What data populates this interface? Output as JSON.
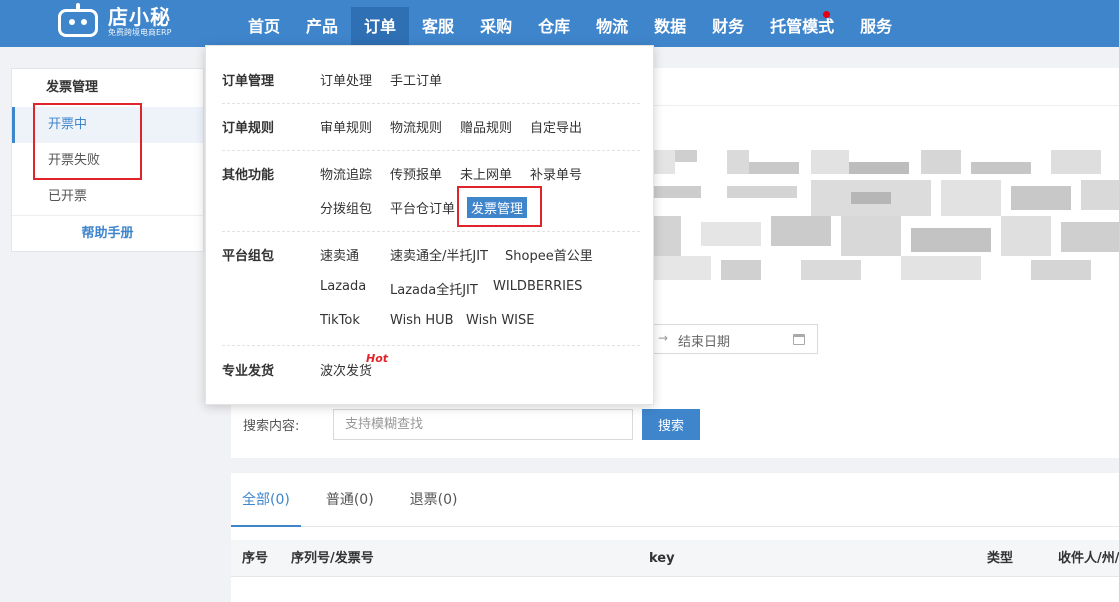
{
  "logo": {
    "name": "店小秘",
    "tagline": "免费跨境电商ERP"
  },
  "nav": {
    "items": [
      {
        "label": "首页"
      },
      {
        "label": "产品"
      },
      {
        "label": "订单"
      },
      {
        "label": "客服"
      },
      {
        "label": "采购"
      },
      {
        "label": "仓库"
      },
      {
        "label": "物流"
      },
      {
        "label": "数据"
      },
      {
        "label": "财务"
      },
      {
        "label": "托管模式"
      },
      {
        "label": "服务"
      }
    ],
    "active_index": 2,
    "badge_index": 9
  },
  "sidebar": {
    "title": "发票管理",
    "items": [
      {
        "label": "开票中"
      },
      {
        "label": "开票失败"
      },
      {
        "label": "已开票"
      }
    ],
    "active_index": 0,
    "help": "帮助手册"
  },
  "dropdown": {
    "groups": [
      {
        "category": "订单管理",
        "links": [
          "订单处理",
          "手工订单"
        ]
      },
      {
        "category": "订单规则",
        "links": [
          "审单规则",
          "物流规则",
          "赠品规则",
          "自定导出"
        ]
      },
      {
        "category": "其他功能",
        "links": [
          "物流追踪",
          "传预报单",
          "未上网单",
          "补录单号",
          "分拨组包",
          "平台仓订单",
          "发票管理"
        ]
      },
      {
        "category": "平台组包",
        "links": [
          "速卖通",
          "速卖通全/半托JIT",
          "Shopee首公里",
          "Lazada",
          "Lazada全托JIT",
          "WILDBERRIES",
          "TikTok",
          "Wish HUB",
          "Wish WISE"
        ]
      },
      {
        "category": "专业发货",
        "links": [
          "波次发货"
        ]
      }
    ],
    "highlighted": "发票管理",
    "hot_tag": "Hot"
  },
  "filters": {
    "date_end_placeholder": "结束日期",
    "search_label": "搜索内容:",
    "search_placeholder": "支持模糊查找",
    "search_button": "搜索"
  },
  "tabs": [
    {
      "label": "全部(0)"
    },
    {
      "label": "普通(0)"
    },
    {
      "label": "退票(0)"
    }
  ],
  "table": {
    "columns": [
      "序号",
      "序列号/发票号",
      "key",
      "类型",
      "收件人/州/省"
    ]
  },
  "colors": {
    "primary": "#3f85cc",
    "nav_active": "#2f6fb4",
    "annotation_red": "#e0242c",
    "badge_red": "#e60012"
  }
}
